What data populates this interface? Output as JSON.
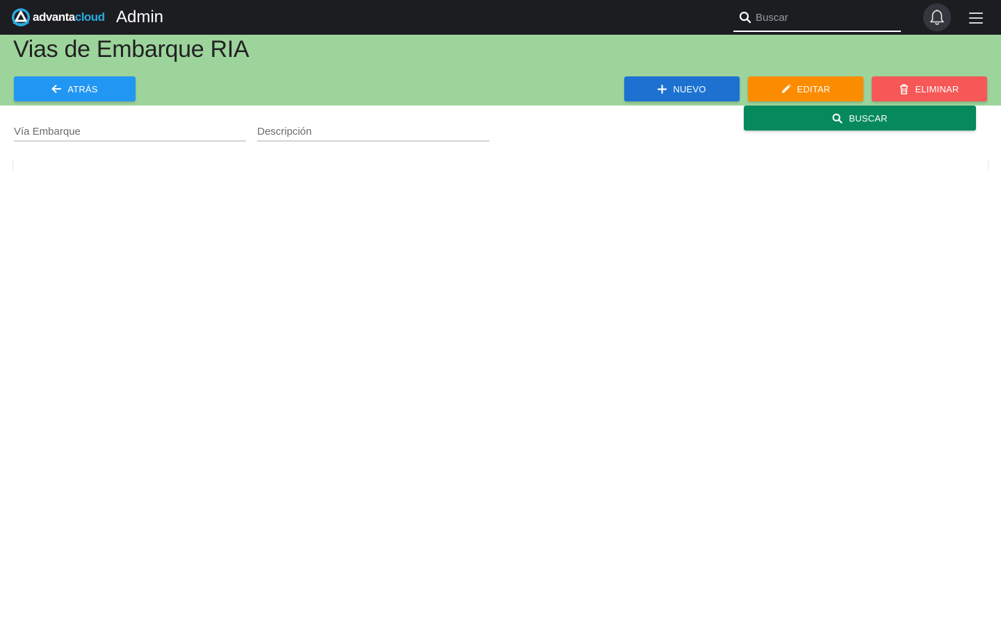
{
  "topbar": {
    "logo": {
      "part1": "advanta",
      "part2": "cloud",
      "icon": "advantacloud-logo-icon"
    },
    "app_title": "Admin",
    "search": {
      "placeholder": "Buscar",
      "value": "",
      "icon": "search-icon"
    },
    "notifications_icon": "bell-icon",
    "menu_icon": "hamburger-menu-icon"
  },
  "page": {
    "title": "Vias de Embarque RIA",
    "header_color": "#9dd49c"
  },
  "toolbar": {
    "back_label": "ATRÁS",
    "new_label": "NUEVO",
    "edit_label": "EDITAR",
    "delete_label": "ELIMINAR",
    "search_label": "BUSCAR"
  },
  "filters": {
    "via_embarque": {
      "label": "Vía Embarque",
      "value": ""
    },
    "descripcion": {
      "label": "Descripción",
      "value": ""
    }
  },
  "colors": {
    "topbar": "#1c1d21",
    "back": "#2196f3",
    "new": "#1d72d1",
    "edit": "#fb8c00",
    "delete": "#f65857",
    "search": "#068a5d",
    "brand_accent": "#29a9e1"
  }
}
